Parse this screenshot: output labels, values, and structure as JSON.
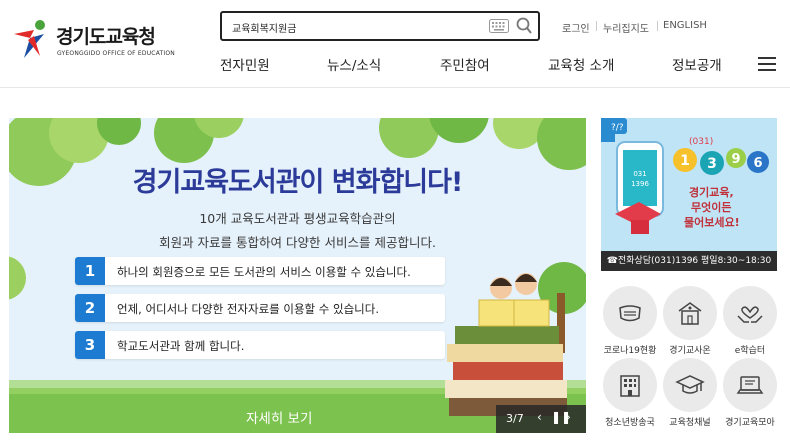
{
  "header": {
    "logo_title": "경기도교육청",
    "logo_sub": "GYEONGGIDO OFFICE OF EDUCATION",
    "search_value": "교육회복지원금",
    "util_links": [
      "로그인",
      "누리집지도",
      "ENGLISH"
    ],
    "gnb": [
      "전자민원",
      "뉴스/소식",
      "주민참여",
      "교육청 소개",
      "정보공개"
    ]
  },
  "banner": {
    "title": "경기교육도서관이 변화합니다!",
    "subtitle_1": "10개 교육도서관과 평생교육학습관의",
    "subtitle_2": "회원과 자료를 통합하여 다양한 서비스를 제공합니다.",
    "features": [
      {
        "num": "1",
        "text": "하나의 회원증으로 모든 도서관의 서비스 이용할 수 있습니다."
      },
      {
        "num": "2",
        "text": "언제, 어디서나 다양한 전자자료를 이용할 수 있습니다."
      },
      {
        "num": "3",
        "text": "학교도서관과 함께 합니다."
      }
    ],
    "more_label": "자세히 보기",
    "pager": "3/7",
    "prev": "‹",
    "pause": "❚❚",
    "next": "›"
  },
  "callcenter": {
    "bubble": "?/?",
    "phone_screen_1": "031",
    "phone_screen_2": "1396",
    "call_digits": [
      "(031)",
      "1",
      "3",
      "9",
      "6"
    ],
    "line_1": "경기교육,",
    "line_2": "무엇이든",
    "line_3": "물어보세요!",
    "footer": "☎전화상담(031)1396 평일8:30~18:30"
  },
  "quick_links": [
    {
      "label": "코로나19현황",
      "icon": "mask-icon"
    },
    {
      "label": "경기교사온",
      "icon": "school-icon"
    },
    {
      "label": "e학습터",
      "icon": "hands-heart-icon"
    },
    {
      "label": "청소년방송국",
      "icon": "building-icon"
    },
    {
      "label": "교육청채널",
      "icon": "graduation-cap-icon"
    },
    {
      "label": "경기교육모아",
      "icon": "laptop-icon"
    }
  ],
  "colors": {
    "brand_blue": "#2c3b9a",
    "accent_blue": "#1e7bd2",
    "call_bg": "#bfe4f6",
    "banner_bg": "#e6f2fb"
  }
}
